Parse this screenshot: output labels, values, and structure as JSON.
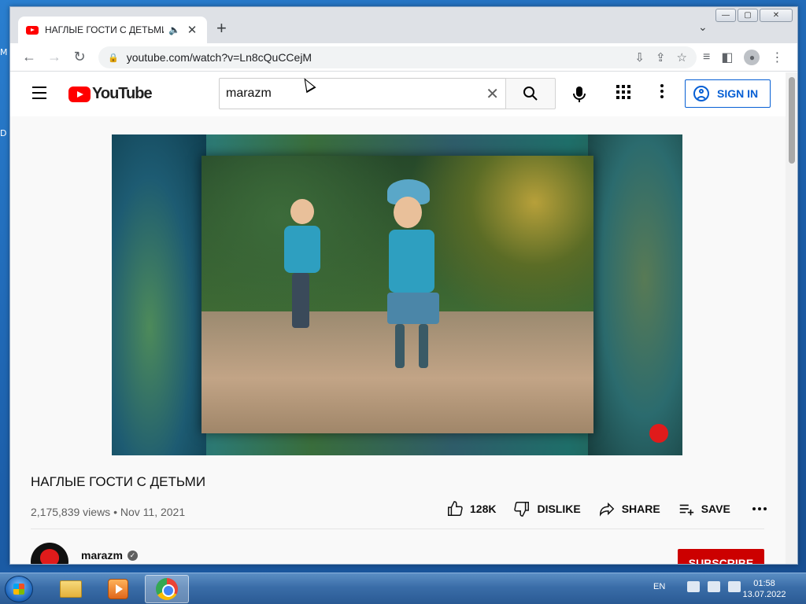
{
  "desktop": {
    "labels": [
      "M",
      "D"
    ]
  },
  "browser": {
    "tab_title": "НАГЛЫЕ ГОСТИ С ДЕТЬМИ",
    "url": "youtube.com/watch?v=Ln8cQuCCejM"
  },
  "youtube": {
    "brand": "YouTube",
    "search_value": "marazm",
    "sign_in_label": "SIGN IN"
  },
  "video": {
    "title": "НАГЛЫЕ ГОСТИ С ДЕТЬМИ",
    "views": "2,175,839 views",
    "date": "Nov 11, 2021",
    "likes": "128K",
    "dislike_label": "DISLIKE",
    "share_label": "SHARE",
    "save_label": "SAVE"
  },
  "channel": {
    "name": "marazm",
    "subscribe_label": "SUBSCRIBE"
  },
  "taskbar": {
    "language": "EN",
    "time": "01:58",
    "date": "13.07.2022"
  },
  "colors": {
    "youtube_red": "#ff0000",
    "accent_blue": "#065fd4",
    "subscribe_red": "#cc0000"
  }
}
